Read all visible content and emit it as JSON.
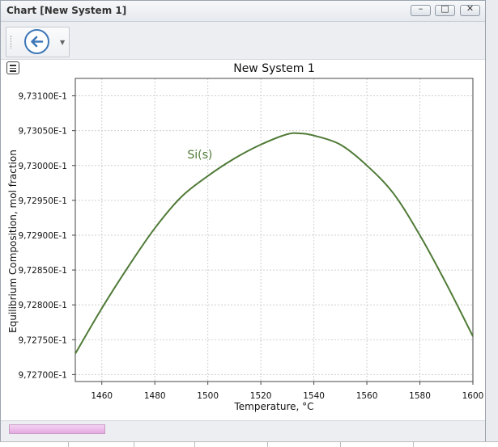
{
  "window": {
    "title": "Chart [New System 1]",
    "buttons": {
      "minimize": "–",
      "maximize": "□",
      "close": "✕"
    }
  },
  "toolbar": {
    "back_icon": "arrow-left-circle-icon",
    "dropdown_icon": "chevron-down-icon"
  },
  "chart_menu_icon": "hamburger-menu-icon",
  "colors": {
    "line": "#4f7a36",
    "accent": "#3e78b8",
    "progress": "#e3a7e0"
  },
  "chart_data": {
    "type": "line",
    "title": "New System 1",
    "xlabel": "Temperature, °C",
    "ylabel": "Equilibrium Composition, mol fraction",
    "xlim": [
      1450,
      1600
    ],
    "ylim": [
      0.97269,
      0.973125
    ],
    "grid": true,
    "xticks": [
      {
        "value": 1460,
        "label": "1460"
      },
      {
        "value": 1480,
        "label": "1480"
      },
      {
        "value": 1500,
        "label": "1500"
      },
      {
        "value": 1520,
        "label": "1520"
      },
      {
        "value": 1540,
        "label": "1540"
      },
      {
        "value": 1560,
        "label": "1560"
      },
      {
        "value": 1580,
        "label": "1580"
      },
      {
        "value": 1600,
        "label": "1600"
      }
    ],
    "yticks": [
      {
        "value": 0.9727,
        "label": "9,72700E-1"
      },
      {
        "value": 0.97275,
        "label": "9,72750E-1"
      },
      {
        "value": 0.9728,
        "label": "9,72800E-1"
      },
      {
        "value": 0.97285,
        "label": "9,72850E-1"
      },
      {
        "value": 0.9729,
        "label": "9,72900E-1"
      },
      {
        "value": 0.97295,
        "label": "9,72950E-1"
      },
      {
        "value": 0.973,
        "label": "9,73000E-1"
      },
      {
        "value": 0.97305,
        "label": "9,73050E-1"
      },
      {
        "value": 0.9731,
        "label": "9,73100E-1"
      }
    ],
    "series": [
      {
        "name": "Si(s)",
        "label_at": {
          "x": 1497,
          "y": 0.97301
        },
        "x": [
          1450,
          1460,
          1470,
          1480,
          1490,
          1500,
          1510,
          1520,
          1530,
          1535,
          1540,
          1550,
          1560,
          1570,
          1580,
          1590,
          1600
        ],
        "y": [
          0.97273,
          0.972795,
          0.972855,
          0.97291,
          0.972955,
          0.972985,
          0.97301,
          0.97303,
          0.973045,
          0.973046,
          0.973043,
          0.97303,
          0.973,
          0.97296,
          0.9729,
          0.97283,
          0.972755
        ]
      }
    ]
  }
}
